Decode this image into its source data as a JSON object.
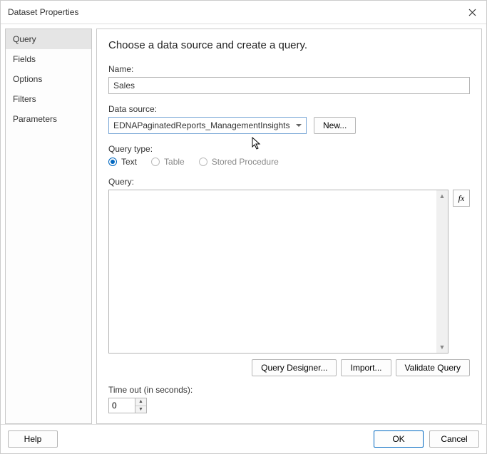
{
  "window": {
    "title": "Dataset Properties"
  },
  "sidebar": {
    "items": [
      {
        "label": "Query",
        "selected": true
      },
      {
        "label": "Fields",
        "selected": false
      },
      {
        "label": "Options",
        "selected": false
      },
      {
        "label": "Filters",
        "selected": false
      },
      {
        "label": "Parameters",
        "selected": false
      }
    ]
  },
  "main": {
    "heading": "Choose a data source and create a query.",
    "name": {
      "label": "Name:",
      "value": "Sales"
    },
    "dataSource": {
      "label": "Data source:",
      "selected": "EDNAPaginatedReports_ManagementInsights",
      "newButton": "New..."
    },
    "queryType": {
      "label": "Query type:",
      "options": [
        {
          "label": "Text",
          "checked": true,
          "disabled": false
        },
        {
          "label": "Table",
          "checked": false,
          "disabled": true
        },
        {
          "label": "Stored Procedure",
          "checked": false,
          "disabled": true
        }
      ]
    },
    "query": {
      "label": "Query:",
      "value": ""
    },
    "fx": "fx",
    "queryButtons": {
      "designer": "Query Designer...",
      "import": "Import...",
      "validate": "Validate Query"
    },
    "timeout": {
      "label": "Time out (in seconds):",
      "value": "0"
    }
  },
  "footer": {
    "help": "Help",
    "ok": "OK",
    "cancel": "Cancel"
  }
}
